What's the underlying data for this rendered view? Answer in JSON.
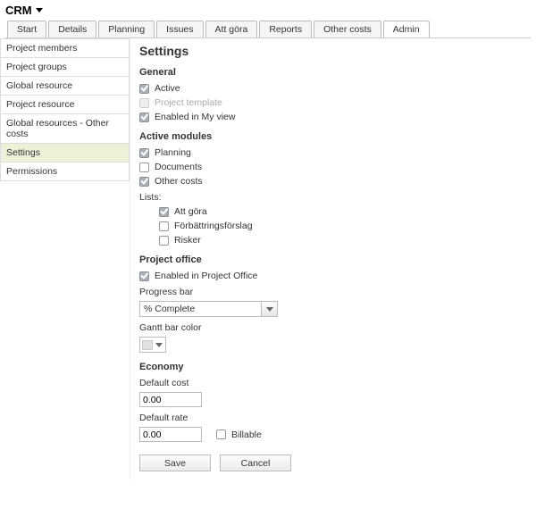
{
  "header": {
    "title": "CRM"
  },
  "tabs": [
    {
      "label": "Start"
    },
    {
      "label": "Details"
    },
    {
      "label": "Planning"
    },
    {
      "label": "Issues"
    },
    {
      "label": "Att göra"
    },
    {
      "label": "Reports"
    },
    {
      "label": "Other costs"
    },
    {
      "label": "Admin"
    }
  ],
  "sidebar": {
    "items": [
      {
        "label": "Project members"
      },
      {
        "label": "Project groups"
      },
      {
        "label": "Global resource"
      },
      {
        "label": "Project resource"
      },
      {
        "label": "Global resources - Other costs"
      },
      {
        "label": "Settings"
      },
      {
        "label": "Permissions"
      }
    ]
  },
  "settings": {
    "title": "Settings",
    "general": {
      "heading": "General",
      "active": "Active",
      "project_template": "Project template",
      "enabled_my_view": "Enabled in My view"
    },
    "modules": {
      "heading": "Active modules",
      "planning": "Planning",
      "documents": "Documents",
      "other_costs": "Other costs",
      "lists_label": "Lists:",
      "lists": {
        "att_gora": "Att göra",
        "forbattring": "Förbättringsförslag",
        "risker": "Risker"
      }
    },
    "project_office": {
      "heading": "Project office",
      "enabled": "Enabled in Project Office",
      "progress_label": "Progress bar",
      "progress_value": "% Complete",
      "color_label": "Gantt bar color"
    },
    "economy": {
      "heading": "Economy",
      "cost_label": "Default cost",
      "cost_value": "0.00",
      "rate_label": "Default rate",
      "rate_value": "0.00",
      "billable": "Billable"
    },
    "buttons": {
      "save": "Save",
      "cancel": "Cancel"
    }
  }
}
